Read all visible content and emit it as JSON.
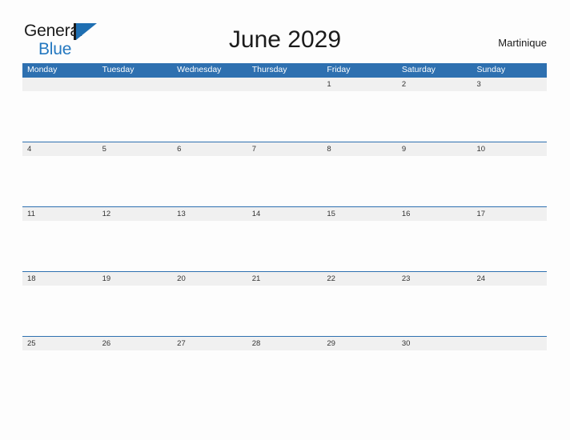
{
  "brand": {
    "name_part1": "General",
    "name_part2": "Blue",
    "mark": "flag-triangle-icon"
  },
  "header": {
    "title": "June 2029",
    "region": "Martinique"
  },
  "colors": {
    "header_blue": "#2e70b0",
    "brand_blue": "#2478c0",
    "date_band_gray": "#f0f0f0",
    "page_background": "#fdfdfd",
    "text_dark": "#1b1b1b",
    "date_text": "#333333"
  },
  "calendar": {
    "weekdays": [
      "Monday",
      "Tuesday",
      "Wednesday",
      "Thursday",
      "Friday",
      "Saturday",
      "Sunday"
    ],
    "weeks": [
      [
        "",
        "",
        "",
        "",
        "1",
        "2",
        "3"
      ],
      [
        "4",
        "5",
        "6",
        "7",
        "8",
        "9",
        "10"
      ],
      [
        "11",
        "12",
        "13",
        "14",
        "15",
        "16",
        "17"
      ],
      [
        "18",
        "19",
        "20",
        "21",
        "22",
        "23",
        "24"
      ],
      [
        "25",
        "26",
        "27",
        "28",
        "29",
        "30",
        ""
      ]
    ]
  }
}
